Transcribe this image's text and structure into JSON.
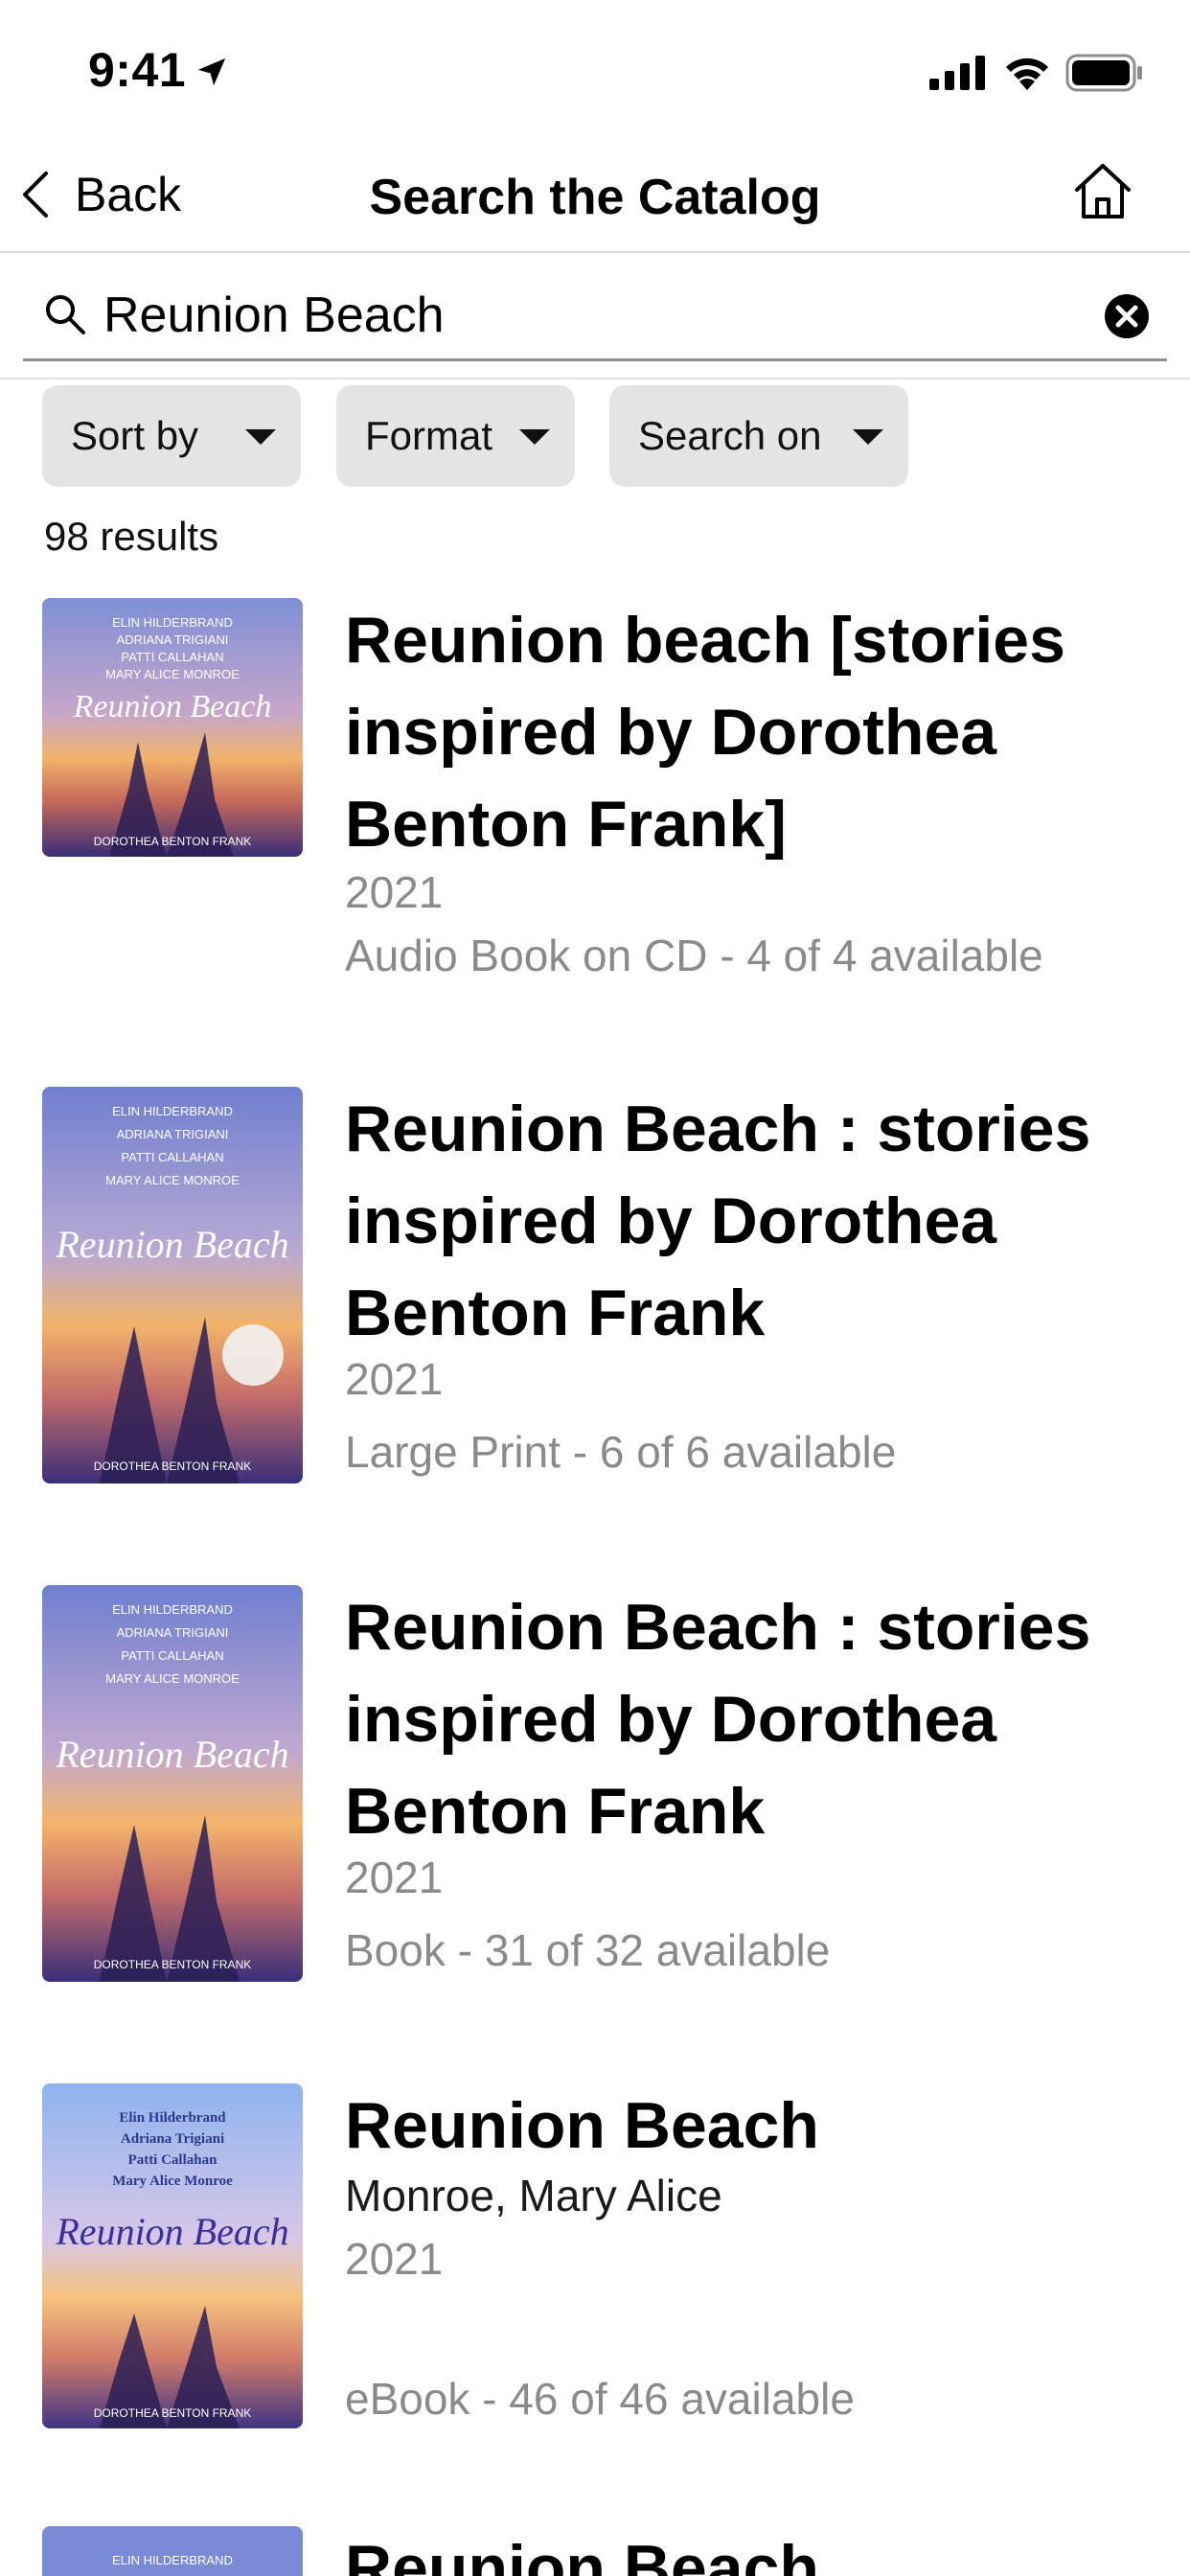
{
  "status_bar": {
    "time": "9:41"
  },
  "nav": {
    "back_label": "Back",
    "title": "Search the Catalog"
  },
  "search": {
    "value": "Reunion Beach",
    "placeholder": ""
  },
  "filters": [
    {
      "label": "Sort by"
    },
    {
      "label": "Format"
    },
    {
      "label": "Search on"
    }
  ],
  "results_count": "98 results",
  "results": [
    {
      "title": "Reunion beach [stories inspired by Dorothea Benton Frank]",
      "year": "2021",
      "availability": "Audio Book on CD - 4 of 4 available"
    },
    {
      "title": "Reunion Beach : stories inspired by Dorothea Benton Frank",
      "year": "2021",
      "availability": "Large Print - 6 of 6 available"
    },
    {
      "title": "Reunion Beach : stories inspired by Dorothea Benton Frank",
      "year": "2021",
      "availability": "Book - 31 of 32 available"
    },
    {
      "title": "Reunion Beach",
      "author": "Monroe, Mary Alice",
      "year": "2021",
      "availability": "eBook - 46 of 46 available"
    },
    {
      "title": "Reunion Beach"
    }
  ],
  "covers": [
    {
      "title_text": "Reunion Beach",
      "authors": [
        "ELIN HILDERBRAND",
        "ADRIANA TRIGIANI",
        "PATTI CALLAHAN",
        "MARY ALICE MONROE"
      ],
      "footer": "DOROTHEA BENTON FRANK"
    },
    {
      "title_text": "Reunion Beach",
      "authors": [
        "ELIN HILDERBRAND",
        "ADRIANA TRIGIANI",
        "PATTI CALLAHAN",
        "MARY ALICE MONROE"
      ],
      "footer": "DOROTHEA BENTON FRANK"
    },
    {
      "title_text": "Reunion Beach",
      "authors": [
        "ELIN HILDERBRAND",
        "ADRIANA TRIGIANI",
        "PATTI CALLAHAN",
        "MARY ALICE MONROE"
      ],
      "footer": "DOROTHEA BENTON FRANK"
    },
    {
      "title_text": "Reunion Beach",
      "authors": [
        "Elin Hilderbrand",
        "Adriana Trigiani",
        "Patti Callahan",
        "Mary Alice Monroe"
      ],
      "footer": "DOROTHEA BENTON FRANK"
    },
    {
      "title_text": "",
      "authors": [
        "ELIN HILDERBRAND"
      ],
      "footer": ""
    }
  ],
  "colors": {
    "chip_bg": "#e4e4e4",
    "meta_gray": "#8a8a8a",
    "cover_sky_top": "#6f7fd0",
    "cover_sunset": "#f2b36a",
    "cover_sea": "#3a2f7a"
  }
}
